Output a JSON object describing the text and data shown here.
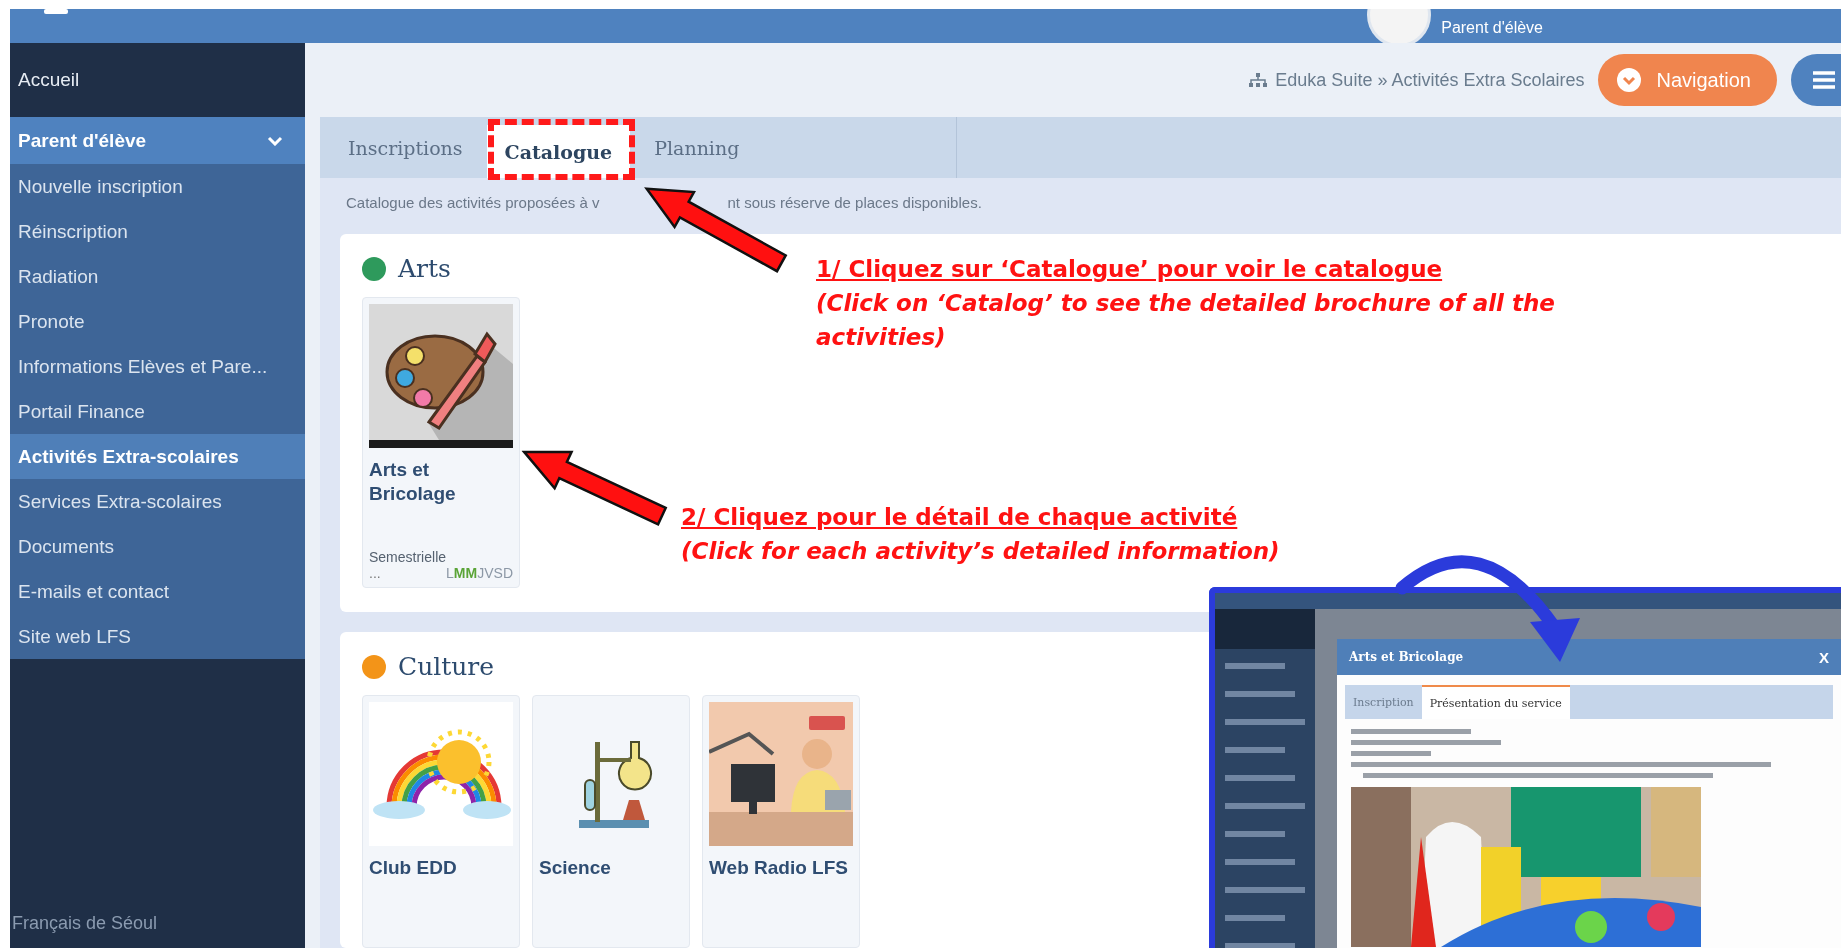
{
  "top_bar": {
    "user_role": "Parent d'élève"
  },
  "sidebar": {
    "home": {
      "label": "Accueil"
    },
    "section": {
      "label": "Parent d'élève",
      "expanded": true,
      "items": [
        {
          "label": "Nouvelle inscription",
          "selected": false
        },
        {
          "label": "Réinscription",
          "selected": false
        },
        {
          "label": "Radiation",
          "selected": false
        },
        {
          "label": "Pronote",
          "selected": false
        },
        {
          "label": "Informations Elèves et Pare...",
          "selected": false
        },
        {
          "label": "Portail Finance",
          "selected": false
        },
        {
          "label": "Activités Extra-scolaires",
          "selected": true
        },
        {
          "label": "Services Extra-scolaires",
          "selected": false
        },
        {
          "label": "Documents",
          "selected": false
        },
        {
          "label": "E-mails et contact",
          "selected": false
        },
        {
          "label": "Site web LFS",
          "selected": false
        }
      ]
    },
    "footer": "Français de Séoul"
  },
  "breadcrumb": "Eduka Suite » Activités Extra Scolaires",
  "navigation_button": "Navigation",
  "tabs": [
    {
      "label": "Inscriptions",
      "selected": false
    },
    {
      "label": "Catalogue",
      "selected": true
    },
    {
      "label": "Planning",
      "selected": false
    }
  ],
  "description_parts": [
    "Catalogue des activités proposées à v",
    "nt sous réserve de places disponibles."
  ],
  "categories": [
    {
      "name": "Arts",
      "color": "#2e9a5c",
      "activities": [
        {
          "title": "Arts et Bricolage",
          "kind": "palette",
          "frequency": "Semestrielle",
          "more": "...",
          "days": [
            {
              "letter": "L",
              "active": false
            },
            {
              "letter": "M",
              "active": true
            },
            {
              "letter": "M",
              "active": true
            },
            {
              "letter": "J",
              "active": false
            },
            {
              "letter": "V",
              "active": false
            },
            {
              "letter": "S",
              "active": false
            },
            {
              "letter": "D",
              "active": false
            }
          ]
        }
      ]
    },
    {
      "name": "Culture",
      "color": "#f39418",
      "activities": [
        {
          "title": "Club EDD",
          "kind": "rainbow"
        },
        {
          "title": "Science",
          "kind": "lab"
        },
        {
          "title": "Web Radio LFS",
          "kind": "radio"
        }
      ]
    }
  ],
  "annotations": [
    {
      "heading": "1/ Cliquez sur ‘Catalogue’ pour voir le catalogue",
      "note": "(Click on ‘Catalog’ to see the detailed brochure of all the activities)"
    },
    {
      "heading": "2/ Cliquez pour le détail de chaque activité",
      "note": "(Click for each activity’s detailed information)"
    }
  ],
  "inset": {
    "modal_title": "Arts et Bricolage",
    "close": "X",
    "tabs": [
      {
        "label": "Inscription",
        "selected": false
      },
      {
        "label": "Présentation du service",
        "selected": true
      }
    ]
  }
}
